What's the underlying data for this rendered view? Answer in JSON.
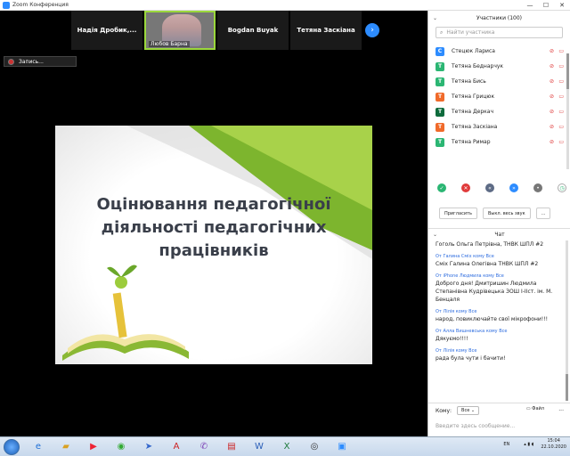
{
  "window": {
    "title": "Zoom Конференция",
    "minimize": "—",
    "maximize": "☐",
    "close": "✕"
  },
  "gallery": {
    "tiles": [
      {
        "name": "Надія  Дробик,...",
        "video": false
      },
      {
        "name": "Любов Барна",
        "video": true
      },
      {
        "name": "Bogdan Buyak",
        "video": false
      },
      {
        "name": "Тетяна Заскіана",
        "video": false
      }
    ],
    "next_icon": "›"
  },
  "recording": {
    "label": "Запись..."
  },
  "slide": {
    "line1": "Оцінювання педагогічної",
    "line2": "діяльності педагогічних",
    "line3": "працівників"
  },
  "participants": {
    "header": "Участники (100)",
    "collapse_icon": "⌄",
    "search_placeholder": "Найти участника",
    "items": [
      {
        "name": "Стецюк Лариса",
        "initial": "С",
        "color": "#2d8cff"
      },
      {
        "name": "Тетяна Беднарчук",
        "initial": "Т",
        "color": "#2bb673"
      },
      {
        "name": "Тетяна Бись",
        "initial": "Т",
        "color": "#2bb673"
      },
      {
        "name": "Тетяна Грицюк",
        "initial": "Т",
        "color": "#f06a2a"
      },
      {
        "name": "Тетяна Деркач",
        "initial": "Т",
        "color": "#0e6b3c"
      },
      {
        "name": "Тетяна Заскіана",
        "initial": "Т",
        "color": "#f06a2a"
      },
      {
        "name": "Тетяна Римар",
        "initial": "Т",
        "color": "#2bb673"
      }
    ],
    "mic_icon": "🎤",
    "cam_icon": "▭",
    "invite": "Пригласить",
    "mute_all": "Выкл. весь звук",
    "more": "..."
  },
  "chat": {
    "header": "Чат",
    "messages": [
      {
        "from": "",
        "text": "Гоголь Ольга Петрівна, ТНВК ШПЛ #2"
      },
      {
        "from": "От Галина Сміх кому Все",
        "text": "Сміх Галина Олегівна ТНВК ШПЛ #2"
      },
      {
        "from": "От iPhone Людмила кому Все",
        "text": "Доброго дня! Дмитришин Людмила Степанівна Кудрівецька ЗОШ І-ІІст. ім. М. Бенцаля"
      },
      {
        "from": "От Лілія кому Все",
        "text": "народ, повиключайте свої мікрофони!!!"
      },
      {
        "from": "От Алла Вишневська кому Все",
        "text": "Дякуємо!!!!"
      },
      {
        "from": "От Лілія кому Все",
        "text": "рада була чути і бачити!"
      }
    ],
    "to_label": "Кому:",
    "to_value": "Все",
    "file_label": "Файл",
    "more": "...",
    "input_placeholder": "Введите здесь сообщение..."
  },
  "taskbar": {
    "lang": "EN",
    "time": "15:04",
    "date": "22.10.2020"
  }
}
